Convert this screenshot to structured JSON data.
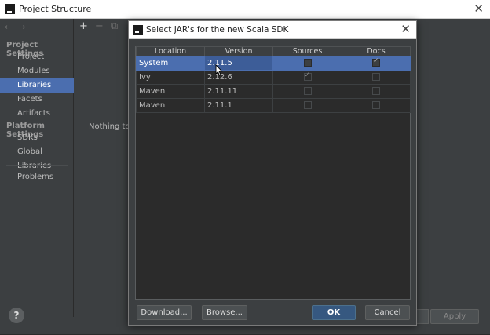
{
  "window": {
    "title": "Project Structure",
    "close_glyph": "✕"
  },
  "sidebar": {
    "nav_back": "←",
    "nav_forward": "→",
    "section_project": "Project Settings",
    "section_platform": "Platform Settings",
    "items": [
      {
        "label": "Project"
      },
      {
        "label": "Modules"
      },
      {
        "label": "Libraries"
      },
      {
        "label": "Facets"
      },
      {
        "label": "Artifacts"
      },
      {
        "label": "SDKs"
      },
      {
        "label": "Global Libraries"
      },
      {
        "label": "Problems"
      }
    ],
    "selected": "Libraries"
  },
  "main": {
    "toolbar_add": "+",
    "toolbar_remove": "−",
    "toolbar_copy": "⧉",
    "empty_text": "Nothing to s"
  },
  "bottom": {
    "help": "?",
    "apply_label": "Apply"
  },
  "dialog": {
    "title": "Select JAR's for the new Scala SDK",
    "close_glyph": "✕",
    "columns": [
      "Location",
      "Version",
      "Sources",
      "Docs"
    ],
    "rows": [
      {
        "location": "System",
        "version": "2.11.5",
        "sources": false,
        "docs": true,
        "selected": true
      },
      {
        "location": "Ivy",
        "version": "2.12.6",
        "sources": true,
        "docs": false,
        "selected": false
      },
      {
        "location": "Maven",
        "version": "2.11.11",
        "sources": false,
        "docs": false,
        "selected": false
      },
      {
        "location": "Maven",
        "version": "2.11.1",
        "sources": false,
        "docs": false,
        "selected": false
      }
    ],
    "buttons": {
      "download": "Download...",
      "browse": "Browse...",
      "ok": "OK",
      "cancel": "Cancel"
    }
  },
  "colors": {
    "background": "#3c3f41",
    "table_bg": "#2b2b2b",
    "selection": "#4b6eaf",
    "primary_button": "#365880"
  }
}
